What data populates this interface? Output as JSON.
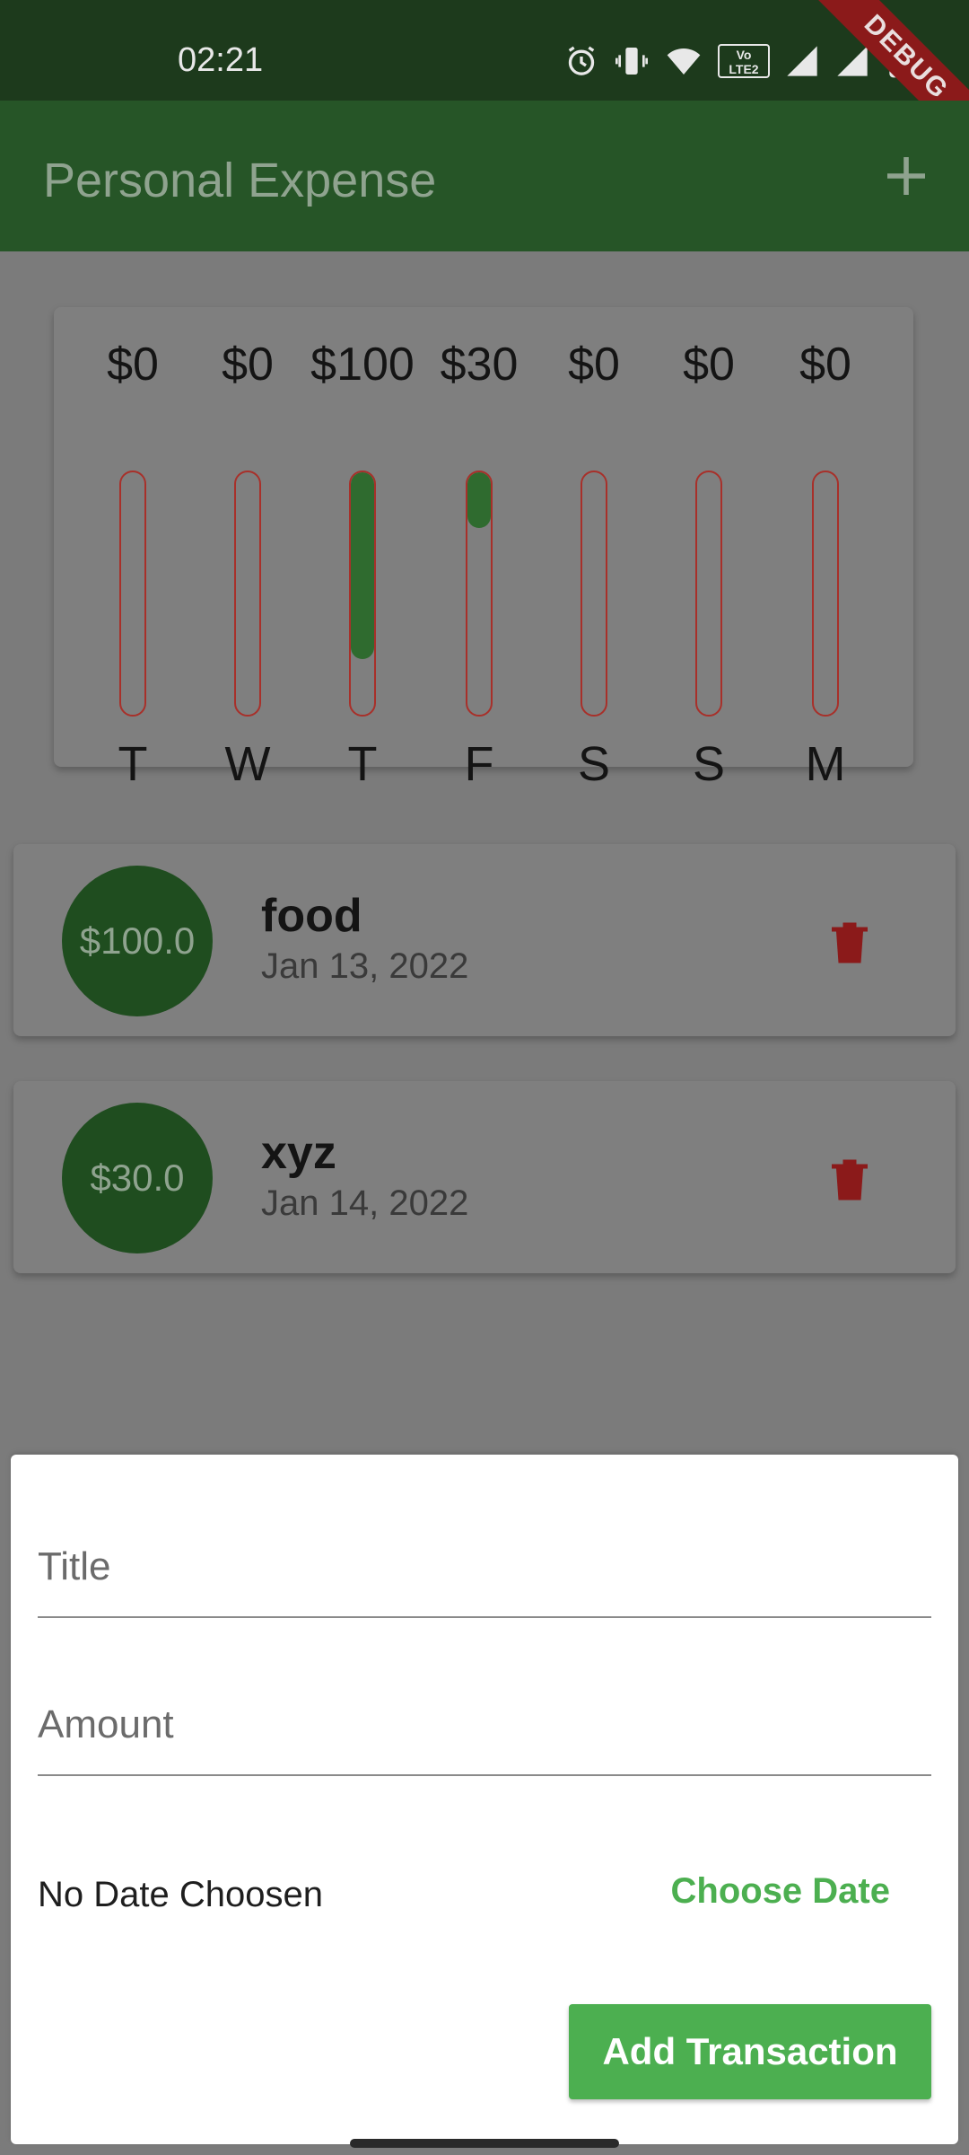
{
  "status_bar": {
    "time": "02:21",
    "icons": [
      "alarm-icon",
      "vibrate-icon",
      "wifi-icon",
      "volte2-icon",
      "signal-r-icon",
      "signal-icon",
      "battery-icon"
    ],
    "network_badge_line1": "Vo",
    "network_badge_line2": "LTE2",
    "debug_label": "DEBUG"
  },
  "app_bar": {
    "title": "Personal Expense",
    "add_icon": "plus-icon"
  },
  "chart": {
    "bars": [
      {
        "day": "T",
        "amount": "$0",
        "fraction": 0.0
      },
      {
        "day": "W",
        "amount": "$0",
        "fraction": 0.0
      },
      {
        "day": "T",
        "amount": "$100",
        "fraction": 0.77
      },
      {
        "day": "F",
        "amount": "$30",
        "fraction": 0.23
      },
      {
        "day": "S",
        "amount": "$0",
        "fraction": 0.0
      },
      {
        "day": "S",
        "amount": "$0",
        "fraction": 0.0
      },
      {
        "day": "M",
        "amount": "$0",
        "fraction": 0.0
      }
    ],
    "colors": {
      "fill": "#2f6b2f",
      "border": "#a8302a"
    }
  },
  "transactions": [
    {
      "amount": "$100.0",
      "title": "food",
      "date": "Jan 13, 2022",
      "delete_icon": "trash-icon"
    },
    {
      "amount": "$30.0",
      "title": "xyz",
      "date": "Jan 14, 2022",
      "delete_icon": "trash-icon"
    }
  ],
  "sheet": {
    "title_placeholder": "Title",
    "amount_placeholder": "Amount",
    "date_status": "No Date Choosen",
    "choose_date_label": "Choose Date",
    "add_label": "Add Transaction",
    "accent": "#4caf50"
  }
}
